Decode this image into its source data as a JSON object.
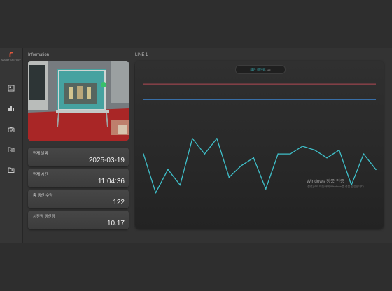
{
  "app": {
    "logo_text": "SMART FACTORY"
  },
  "sidebar": {
    "items": [
      {
        "icon": "dashboard-icon"
      },
      {
        "icon": "production-chart-icon"
      },
      {
        "icon": "camera-icon"
      },
      {
        "icon": "folder-search-icon"
      },
      {
        "icon": "folder-export-icon"
      }
    ]
  },
  "info": {
    "title": "Information",
    "cards": [
      {
        "label": "현재 날짜",
        "value": "2025-03-19"
      },
      {
        "label": "현재 시간",
        "value": "11:04:36"
      },
      {
        "label": "총 생산 수량",
        "value": "122"
      },
      {
        "label": "시간당 생산량",
        "value": "10.17"
      }
    ]
  },
  "line": {
    "title": "LINE 1",
    "pill_label": "최근 생산량",
    "pill_value": ": 12"
  },
  "chart_data": {
    "type": "line",
    "x": [
      1,
      2,
      3,
      4,
      5,
      6,
      7,
      8,
      9,
      10,
      11,
      12,
      13,
      14,
      15,
      16,
      17,
      18,
      19,
      20
    ],
    "series": [
      {
        "values": [
          13,
          8,
          11,
          9,
          15,
          13,
          15,
          10,
          11.5,
          12.5,
          8.5,
          13,
          13,
          14,
          13.5,
          12.5,
          13.5,
          9,
          13,
          11
        ]
      }
    ],
    "reference_lines": [
      {
        "value": 22,
        "color": "#b34a55"
      },
      {
        "value": 20,
        "color": "#3a78b8"
      }
    ],
    "ylim": [
      5,
      23
    ],
    "colors": {
      "series": "#3fbfc9"
    }
  },
  "watermark": {
    "title": "Windows 정품 인증",
    "subtitle": "[설정]으로 이동하여 Windows를 정품 인증합니다."
  }
}
